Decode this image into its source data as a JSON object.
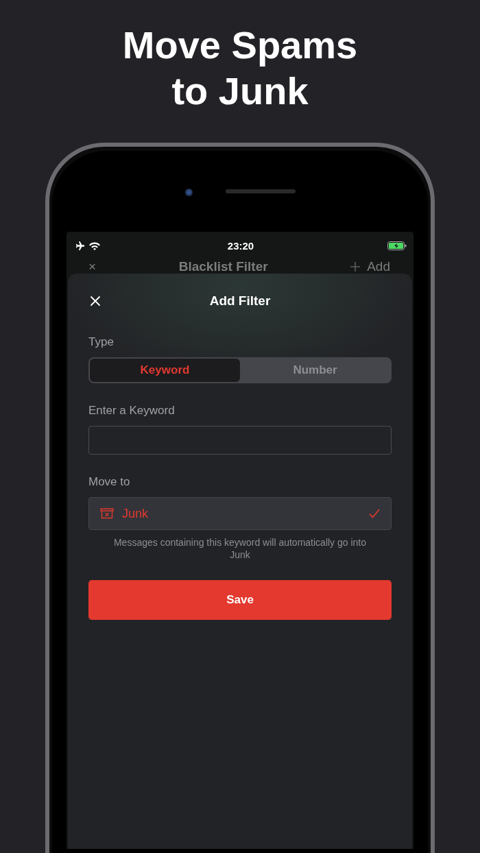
{
  "headline": [
    "Move Spams",
    "to Junk"
  ],
  "status_bar": {
    "time": "23:20"
  },
  "background_nav": {
    "close": "×",
    "title": "Blacklist Filter",
    "action": "Add"
  },
  "sheet": {
    "title": "Add Filter",
    "type_label": "Type",
    "segments": [
      {
        "label": "Keyword",
        "selected": true
      },
      {
        "label": "Number",
        "selected": false
      }
    ],
    "keyword_label": "Enter a Keyword",
    "move_to_label": "Move to",
    "destination": {
      "label": "Junk",
      "checked": true
    },
    "help": "Messages containing this keyword will automatically go into Junk",
    "save": "Save"
  }
}
